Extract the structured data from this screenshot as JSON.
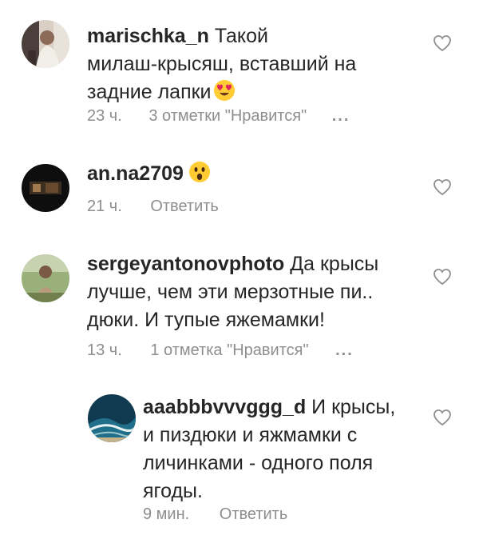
{
  "comments": [
    {
      "username": "marischka_n",
      "text_line1": " Такой",
      "text_line2": "милаш-крысяш, вставший на",
      "text_line3": "задние лапки",
      "emoji": "heart-eyes-emoji",
      "time": "23 ч.",
      "likes": "3 отметки \"Нравится\"",
      "more": "...",
      "avatar": "portrait-avatar"
    },
    {
      "username": "an.na2709",
      "emoji": "astonished-emoji",
      "time": "21 ч.",
      "reply": "Ответить",
      "avatar": "dark-photo-avatar"
    },
    {
      "username": "sergeyantonovphoto",
      "text_line1": " Да крысы",
      "text_line2": "лучше, чем эти мерзотные пи..",
      "text_line3": "дюки. И тупые яжемамки!",
      "time": "13 ч.",
      "likes": "1 отметка \"Нравится\"",
      "more": "...",
      "avatar": "outdoor-photo-avatar"
    },
    {
      "username": "aaabbbvvvggg_d",
      "text_line1": " И крысы,",
      "text_line2": "и пиздюки и яжмамки с",
      "text_line3": "личинками - одного поля",
      "text_line4": "ягоды.",
      "time": "9 мин.",
      "reply": "Ответить",
      "avatar": "ocean-photo-avatar"
    }
  ],
  "colors": {
    "text": "#262626",
    "meta": "#8e8e8e",
    "background": "#ffffff"
  },
  "icons": {
    "like": "heart-outline-icon"
  }
}
